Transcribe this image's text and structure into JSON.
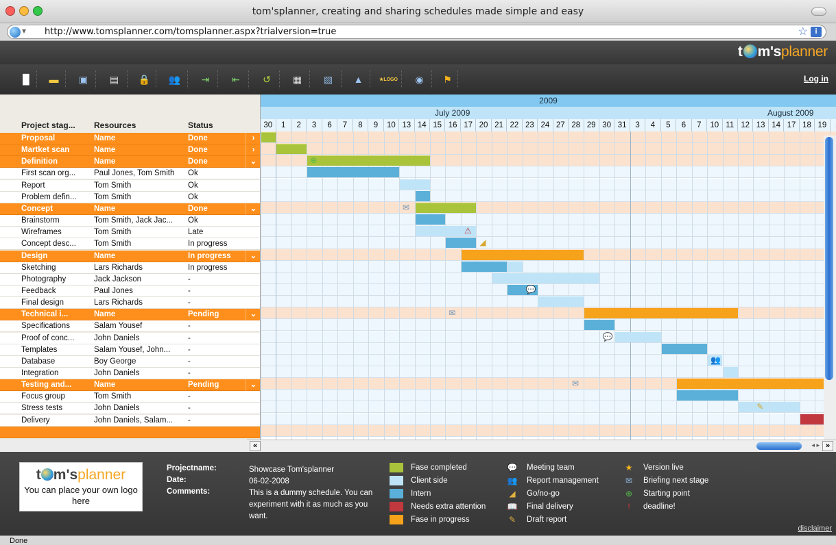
{
  "window": {
    "title": "tom'splanner, creating and sharing schedules made simple and easy"
  },
  "browser": {
    "url": "http://www.tomsplanner.com/tomsplanner.aspx?trialversion=true",
    "status": "Done"
  },
  "brand": {
    "part1": "t",
    "part2": "m's",
    "part3": "planner"
  },
  "toolbar": {
    "icons": [
      "new-document-icon",
      "open-folder-icon",
      "save-icon",
      "print-icon",
      "lock-icon",
      "share-users-icon",
      "import-icon",
      "export-icon",
      "undo-icon",
      "view-icon",
      "edit-chart-icon",
      "warning-icon",
      "logo-icon",
      "help-icon",
      "flag-icon"
    ],
    "logo_label": "★LOGO",
    "login": "Log in"
  },
  "columns": {
    "stage": "Project stag...",
    "resources": "Resources",
    "status": "Status"
  },
  "rows": [
    {
      "type": "stage",
      "name": "Proposal",
      "res": "Name",
      "status": "Done",
      "arrow": "›"
    },
    {
      "type": "stage",
      "name": "Martket scan",
      "res": "Name",
      "status": "Done",
      "arrow": "›"
    },
    {
      "type": "stage",
      "name": "Definition",
      "res": "Name",
      "status": "Done",
      "arrow": "⌄"
    },
    {
      "type": "task",
      "name": "First scan org...",
      "res": "Paul Jones, Tom Smith",
      "status": "Ok"
    },
    {
      "type": "task",
      "name": "Report",
      "res": "Tom Smith",
      "status": "Ok"
    },
    {
      "type": "task",
      "name": "Problem defin...",
      "res": "Tom Smith",
      "status": "Ok"
    },
    {
      "type": "stage",
      "name": "Concept",
      "res": "Name",
      "status": "Done",
      "arrow": "⌄"
    },
    {
      "type": "task",
      "name": "Brainstorm",
      "res": "Tom Smith, Jack Jac...",
      "status": "Ok"
    },
    {
      "type": "task",
      "name": "Wireframes",
      "res": "Tom Smith",
      "status": "Late"
    },
    {
      "type": "task",
      "name": "Concept desc...",
      "res": "Tom Smith",
      "status": "In progress"
    },
    {
      "type": "stage",
      "name": "Design",
      "res": "Name",
      "status": "In progress",
      "arrow": "⌄"
    },
    {
      "type": "task",
      "name": "Sketching",
      "res": "Lars Richards",
      "status": "In progress"
    },
    {
      "type": "task",
      "name": "Photography",
      "res": "Jack Jackson",
      "status": "-"
    },
    {
      "type": "task",
      "name": "Feedback",
      "res": "Paul Jones",
      "status": "-"
    },
    {
      "type": "task",
      "name": "Final design",
      "res": "Lars Richards",
      "status": "-"
    },
    {
      "type": "stage",
      "name": "Technical i...",
      "res": "Name",
      "status": "Pending",
      "arrow": "⌄"
    },
    {
      "type": "task",
      "name": "Specifications",
      "res": "Salam Yousef",
      "status": "-"
    },
    {
      "type": "task",
      "name": "Proof of conc...",
      "res": "John Daniels",
      "status": "-"
    },
    {
      "type": "task",
      "name": "Templates",
      "res": "Salam Yousef, John...",
      "status": "-"
    },
    {
      "type": "task",
      "name": "Database",
      "res": "Boy George",
      "status": "-"
    },
    {
      "type": "task",
      "name": "Integration",
      "res": "John Daniels",
      "status": "-"
    },
    {
      "type": "stage",
      "name": "Testing and...",
      "res": "Name",
      "status": "Pending",
      "arrow": "⌄"
    },
    {
      "type": "task",
      "name": "Focus group",
      "res": "Tom Smith",
      "status": "-"
    },
    {
      "type": "task",
      "name": "Stress tests",
      "res": "John Daniels",
      "status": "-"
    },
    {
      "type": "task",
      "name": "Delivery",
      "res": "John Daniels, Salam...",
      "status": "-"
    },
    {
      "type": "stage",
      "name": "",
      "res": "",
      "status": "",
      "arrow": ""
    }
  ],
  "timeline": {
    "year": "2009",
    "months": [
      "July 2009",
      "August 2009"
    ],
    "days": [
      "30",
      "1",
      "2",
      "3",
      "6",
      "7",
      "8",
      "9",
      "10",
      "13",
      "14",
      "15",
      "16",
      "17",
      "20",
      "21",
      "22",
      "23",
      "24",
      "27",
      "28",
      "29",
      "30",
      "31",
      "3",
      "4",
      "5",
      "6",
      "7",
      "10",
      "11",
      "12",
      "13",
      "14",
      "17",
      "18",
      "19",
      "2"
    ]
  },
  "bars": [
    {
      "row": 0,
      "start": 0,
      "end": 1,
      "color": "green"
    },
    {
      "row": 1,
      "start": 1,
      "end": 3,
      "color": "green"
    },
    {
      "row": 2,
      "start": 3,
      "end": 11,
      "color": "green"
    },
    {
      "row": 3,
      "start": 3,
      "end": 9,
      "color": "blue"
    },
    {
      "row": 4,
      "start": 9,
      "end": 11,
      "color": "lblue"
    },
    {
      "row": 5,
      "start": 10,
      "end": 11,
      "color": "blue"
    },
    {
      "row": 6,
      "start": 10,
      "end": 14,
      "color": "green"
    },
    {
      "row": 7,
      "start": 10,
      "end": 12,
      "color": "blue"
    },
    {
      "row": 8,
      "start": 10,
      "end": 14,
      "color": "lblue"
    },
    {
      "row": 9,
      "start": 12,
      "end": 14,
      "color": "blue"
    },
    {
      "row": 10,
      "start": 13,
      "end": 21,
      "color": "orange"
    },
    {
      "row": 11,
      "start": 13,
      "end": 16,
      "color": "blue"
    },
    {
      "row": 11,
      "start": 16,
      "end": 17,
      "color": "lblue"
    },
    {
      "row": 12,
      "start": 15,
      "end": 22,
      "color": "lblue"
    },
    {
      "row": 13,
      "start": 16,
      "end": 18,
      "color": "blue"
    },
    {
      "row": 14,
      "start": 18,
      "end": 21,
      "color": "lblue"
    },
    {
      "row": 15,
      "start": 21,
      "end": 31,
      "color": "orange"
    },
    {
      "row": 16,
      "start": 21,
      "end": 23,
      "color": "blue"
    },
    {
      "row": 17,
      "start": 23,
      "end": 26,
      "color": "lblue"
    },
    {
      "row": 18,
      "start": 26,
      "end": 29,
      "color": "blue"
    },
    {
      "row": 19,
      "start": 29,
      "end": 30,
      "color": "lblue"
    },
    {
      "row": 20,
      "start": 30,
      "end": 31,
      "color": "lblue"
    },
    {
      "row": 21,
      "start": 27,
      "end": 37,
      "color": "orange"
    },
    {
      "row": 22,
      "start": 27,
      "end": 31,
      "color": "blue"
    },
    {
      "row": 23,
      "start": 31,
      "end": 33,
      "color": "lblue"
    },
    {
      "row": 23,
      "start": 33,
      "end": 35,
      "color": "lblue"
    },
    {
      "row": 24,
      "start": 35,
      "end": 37,
      "color": "red"
    }
  ],
  "markers": [
    {
      "row": 2,
      "col": 3,
      "name": "starting-point-icon",
      "glyph": "⊕",
      "color": "#55b84a"
    },
    {
      "row": 6,
      "col": 9,
      "name": "briefing-icon",
      "glyph": "✉",
      "color": "#6f95b8"
    },
    {
      "row": 8,
      "col": 13,
      "name": "deadline-icon",
      "glyph": "⚠",
      "color": "#c8323a"
    },
    {
      "row": 9,
      "col": 14,
      "name": "gonogo-icon",
      "glyph": "◢",
      "color": "#d7a52c"
    },
    {
      "row": 13,
      "col": 17,
      "name": "meeting-icon",
      "glyph": "💬",
      "color": "#6f95b8"
    },
    {
      "row": 15,
      "col": 12,
      "name": "briefing-icon",
      "glyph": "✉",
      "color": "#6f95b8"
    },
    {
      "row": 17,
      "col": 22,
      "name": "meeting-icon",
      "glyph": "💬",
      "color": "#6f95b8"
    },
    {
      "row": 19,
      "col": 29,
      "name": "report-management-icon",
      "glyph": "👥",
      "color": "#5b86b6"
    },
    {
      "row": 21,
      "col": 20,
      "name": "briefing-icon",
      "glyph": "✉",
      "color": "#6f95b8"
    },
    {
      "row": 23,
      "col": 32,
      "name": "draft-report-icon",
      "glyph": "✎",
      "color": "#d7a52c"
    }
  ],
  "colors": {
    "green": "#a9c33a",
    "lblue": "#bfe4f8",
    "blue": "#5ab0d8",
    "orange": "#f7a21b",
    "red": "#c2383f"
  },
  "footer": {
    "logo_text": "t m's planner",
    "logo_note": "You can place your own logo here",
    "project_label": "Projectname:",
    "project_value": "Showcase Tom'splanner",
    "date_label": "Date:",
    "date_value": "06-02-2008",
    "comments_label": "Comments:",
    "comments_value": "This is a dummy schedule. You can experiment with it as much as you want.",
    "legend_colors": [
      {
        "label": "Fase completed",
        "color": "#a9c33a"
      },
      {
        "label": "Client side",
        "color": "#bfe4f8"
      },
      {
        "label": "Intern",
        "color": "#5ab0d8"
      },
      {
        "label": "Needs extra attention",
        "color": "#c2383f"
      },
      {
        "label": "Fase in progress",
        "color": "#f7a21b"
      }
    ],
    "legend_icons1": [
      {
        "label": "Meeting team",
        "icon": "meeting-team-icon",
        "glyph": "💬",
        "color": "#8fb7e0"
      },
      {
        "label": "Report management",
        "icon": "report-management-icon",
        "glyph": "👥",
        "color": "#8fb7e0"
      },
      {
        "label": "Go/no-go",
        "icon": "gonogo-icon",
        "glyph": "◢",
        "color": "#e0b040"
      },
      {
        "label": "Final delivery",
        "icon": "final-delivery-icon",
        "glyph": "📖",
        "color": "#8fb7e0"
      },
      {
        "label": "Draft report",
        "icon": "draft-report-icon",
        "glyph": "✎",
        "color": "#e0b040"
      }
    ],
    "legend_icons2": [
      {
        "label": "Version live",
        "icon": "version-live-icon",
        "glyph": "★",
        "color": "#f5b41c"
      },
      {
        "label": "Briefing next stage",
        "icon": "briefing-icon",
        "glyph": "✉",
        "color": "#8fb7e0"
      },
      {
        "label": "Starting point",
        "icon": "starting-point-icon",
        "glyph": "⊕",
        "color": "#55b84a"
      },
      {
        "label": "deadline!",
        "icon": "deadline-icon",
        "glyph": "!",
        "color": "#d9333a"
      }
    ],
    "disclaimer": "disclaimer"
  }
}
